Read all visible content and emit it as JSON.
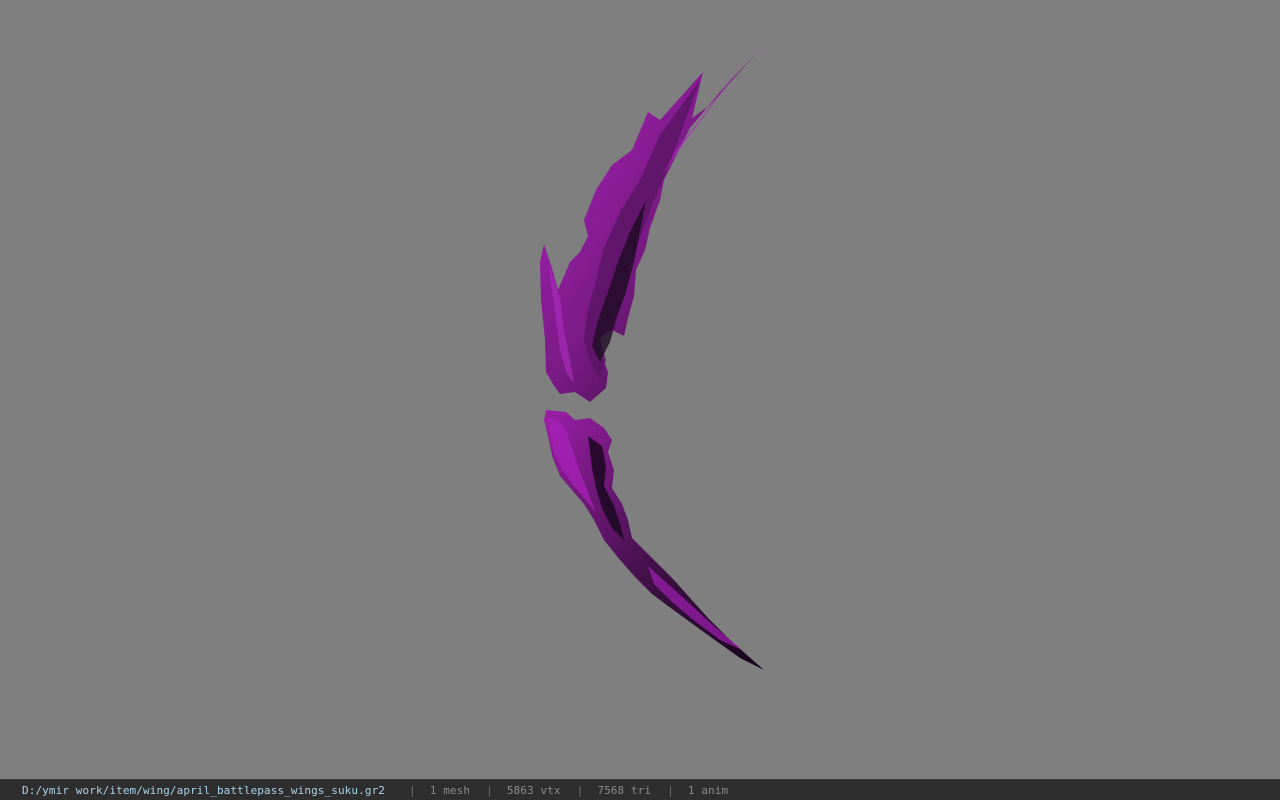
{
  "viewport": {
    "background_color": "#7f7f7f",
    "model_color": "#7a1a85",
    "model_highlight_color": "#a21fb0",
    "model_shadow_color": "#1c0a1f",
    "model_description": "wing-mesh"
  },
  "status_bar": {
    "file_path": "D:/ymir work/item/wing/april_battlepass_wings_suku.gr2",
    "separator": "|",
    "mesh_count": "1 mesh",
    "vertex_count": "5863 vtx",
    "triangle_count": "7568 tri",
    "anim_count": "1 anim",
    "path_color": "#a9d4ea",
    "text_color": "#8a8a8a",
    "background_color": "#2e2e2e"
  }
}
